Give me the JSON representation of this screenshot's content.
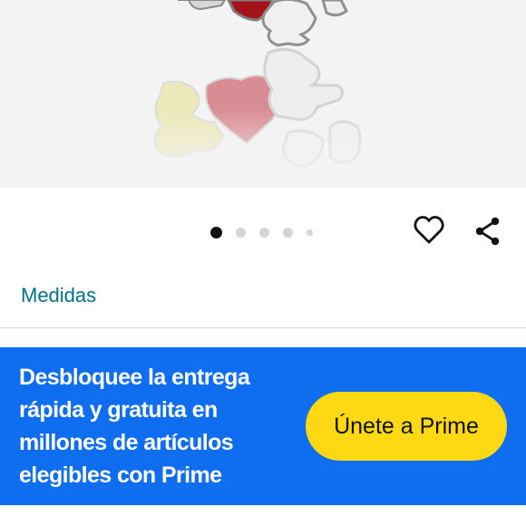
{
  "product": {
    "image_alt": "Dije de plata con perrito y corazón rojo",
    "image_count": 5,
    "current_image_index": 0
  },
  "actions": {
    "heart_icon": "heart-outline-icon",
    "share_icon": "share-icon"
  },
  "sizes": {
    "link_label": "Medidas"
  },
  "prime": {
    "promo_lines": [
      "Desbloquee la entrega",
      "rápida y gratuita en",
      "millones de artículos",
      "elegibles con Prime"
    ],
    "button_label": "Únete a Prime"
  },
  "colors": {
    "link": "#007185",
    "prime_blue": "#0F6EF0",
    "prime_button": "#FFD814"
  }
}
